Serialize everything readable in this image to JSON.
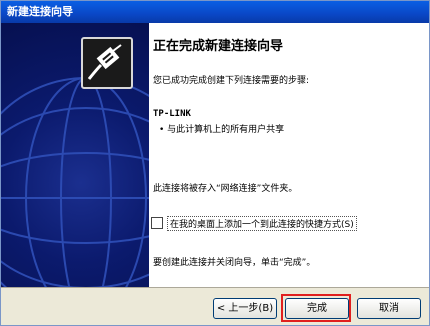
{
  "window": {
    "title": "新建连接向导"
  },
  "content": {
    "heading": "正在完成新建连接向导",
    "intro": "您已成功完成创建下列连接需要的步骤:",
    "connection_name": "TP-LINK",
    "bullet": "• 与此计算机上的所有用户共享",
    "saved_note": "此连接将被存入“网络连接”文件夹。",
    "checkbox_label": "在我的桌面上添加一个到此连接的快捷方式(S)",
    "checkbox_checked": false,
    "finish_note": "要创建此连接并关闭向导，单击“完成”。"
  },
  "buttons": {
    "back": "< 上一步(B)",
    "finish": "完成",
    "cancel": "取消"
  },
  "icons": {
    "wizard": "network-plug-icon"
  }
}
